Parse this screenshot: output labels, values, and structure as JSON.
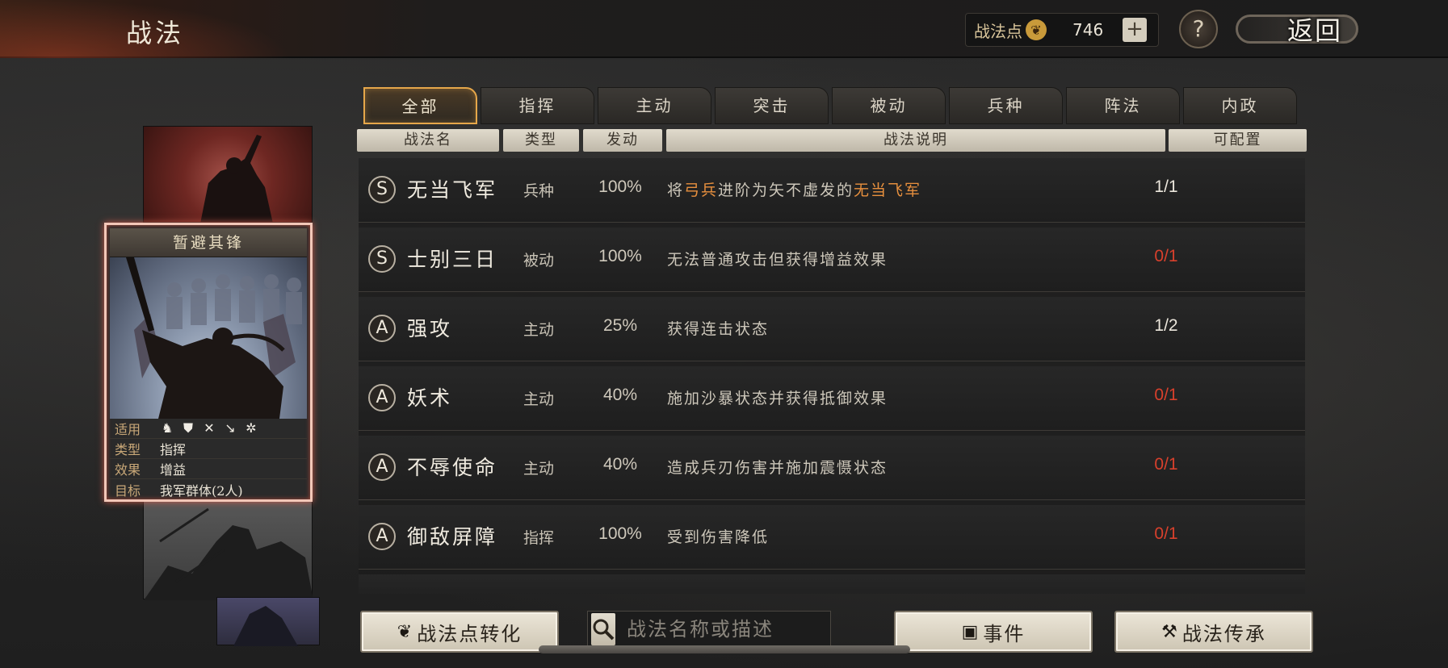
{
  "header": {
    "title": "战法",
    "points_label": "战法点",
    "points_value": "746",
    "plus_label": "+",
    "help_label": "?",
    "back_label": "返回"
  },
  "tabs": [
    {
      "label": "全部",
      "active": true
    },
    {
      "label": "指挥",
      "active": false
    },
    {
      "label": "主动",
      "active": false
    },
    {
      "label": "突击",
      "active": false
    },
    {
      "label": "被动",
      "active": false
    },
    {
      "label": "兵种",
      "active": false
    },
    {
      "label": "阵法",
      "active": false
    },
    {
      "label": "内政",
      "active": false
    }
  ],
  "columns": {
    "name": "战法名",
    "type": "类型",
    "rate": "发动",
    "desc": "战法说明",
    "slots": "可配置"
  },
  "rows": [
    {
      "grade": "S",
      "name": "无当飞军",
      "type": "兵种",
      "rate": "100%",
      "desc_parts": [
        "将",
        "弓兵",
        "进阶为矢不虚发的",
        "无当飞军"
      ],
      "slots": "1/1",
      "slots_red": false
    },
    {
      "grade": "S",
      "name": "士别三日",
      "type": "被动",
      "rate": "100%",
      "desc": "无法普通攻击但获得增益效果",
      "slots": "0/1",
      "slots_red": true
    },
    {
      "grade": "A",
      "name": "强攻",
      "type": "主动",
      "rate": "25%",
      "desc": "获得连击状态",
      "slots": "1/2",
      "slots_red": false
    },
    {
      "grade": "A",
      "name": "妖术",
      "type": "主动",
      "rate": "40%",
      "desc": "施加沙暴状态并获得抵御效果",
      "slots": "0/1",
      "slots_red": true
    },
    {
      "grade": "A",
      "name": "不辱使命",
      "type": "主动",
      "rate": "40%",
      "desc": "造成兵刃伤害并施加震慑状态",
      "slots": "0/1",
      "slots_red": true
    },
    {
      "grade": "A",
      "name": "御敌屏障",
      "type": "指挥",
      "rate": "100%",
      "desc": "受到伤害降低",
      "slots": "0/1",
      "slots_red": true
    }
  ],
  "featured_card": {
    "title": "暂避其锋",
    "info": [
      {
        "key": "适用",
        "value": ""
      },
      {
        "key": "类型",
        "value": "指挥"
      },
      {
        "key": "效果",
        "value": "增益"
      },
      {
        "key": "目标",
        "value": "我军群体(2人)"
      }
    ],
    "unit_icons": [
      "cavalry-icon",
      "shield-icon",
      "crossed-bows-icon",
      "spear-icon",
      "wheel-icon"
    ]
  },
  "bottom": {
    "convert_label": "战法点转化",
    "search_placeholder": "战法名称或描述",
    "event_label": "事件",
    "inherit_label": "战法传承"
  },
  "colors": {
    "accent": "#e6a74a",
    "highlight": "#e8903e",
    "red": "#d8402c"
  }
}
